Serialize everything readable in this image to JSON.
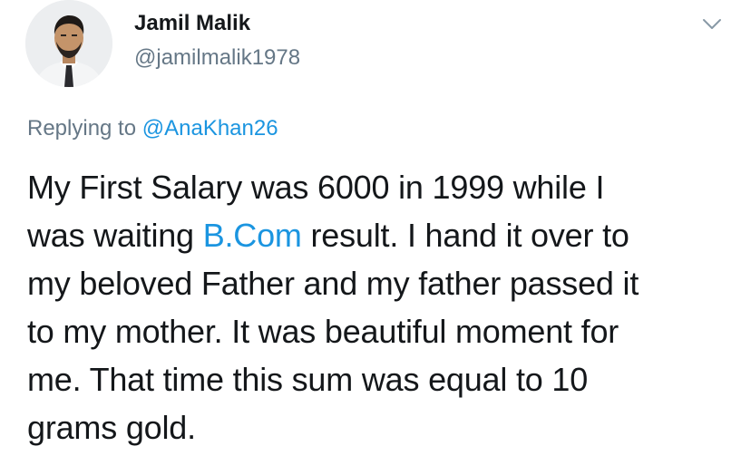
{
  "author": {
    "display_name": "Jamil Malik",
    "handle": "@jamilmalik1978"
  },
  "menu_icon": "chevron-down-icon",
  "reply": {
    "prefix": "Replying to ",
    "mention": "@AnaKhan26"
  },
  "tweet": {
    "line1": "My First Salary was 6000 in 1999 while I",
    "line2_before": "was waiting ",
    "line2_link": "B.Com",
    "line2_after": " result. I hand it over to",
    "line3": "my beloved Father and my father passed it",
    "line4": "to my mother. It was beautiful moment for",
    "line5": "me. That time this sum was equal to 10",
    "line6": "grams gold."
  },
  "colors": {
    "text": "#14171a",
    "secondary": "#657786",
    "link": "#1b95e0"
  }
}
